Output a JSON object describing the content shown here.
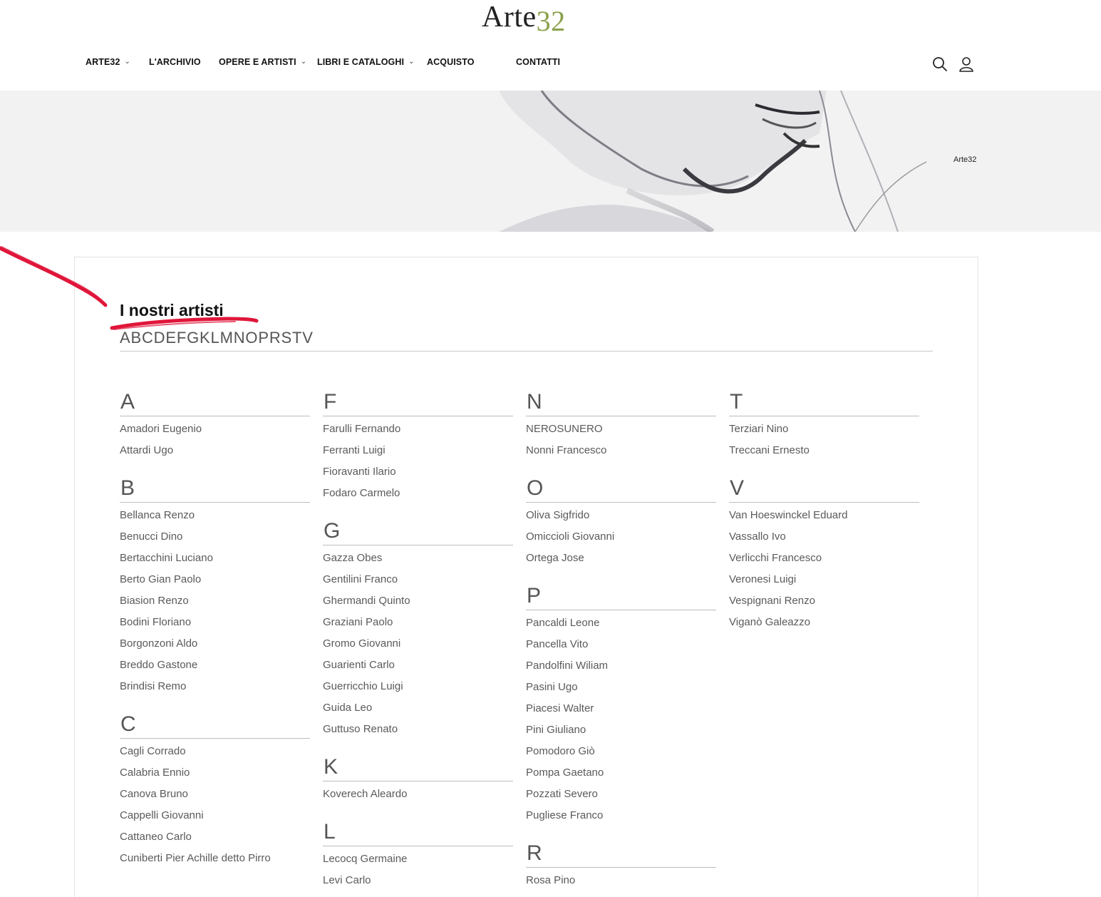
{
  "header": {
    "logo_text": "Arte",
    "logo_num": "32",
    "nav": [
      {
        "label": "ARTE32",
        "dropdown": true
      },
      {
        "label": "L'ARCHIVIO",
        "dropdown": false
      },
      {
        "label": "OPERE E ARTISTI",
        "dropdown": true
      },
      {
        "label": "LIBRI E CATALOGHI",
        "dropdown": true
      },
      {
        "label": "ACQUISTO",
        "dropdown": false
      },
      {
        "label": "CONTATTI",
        "dropdown": false
      }
    ],
    "icons": [
      "search-icon",
      "user-icon"
    ]
  },
  "hero": {
    "breadcrumb": "Arte32"
  },
  "main": {
    "title": "I nostri artisti",
    "alphabet": [
      "A",
      "B",
      "C",
      "D",
      "E",
      "F",
      "G",
      "K",
      "L",
      "M",
      "N",
      "O",
      "P",
      "R",
      "S",
      "T",
      "V"
    ]
  },
  "columns": [
    [
      {
        "letter": "A",
        "artists": [
          "Amadori Eugenio",
          "Attardi Ugo"
        ]
      },
      {
        "letter": "B",
        "artists": [
          "Bellanca Renzo",
          "Benucci Dino",
          "Bertacchini Luciano",
          "Berto Gian Paolo",
          "Biasion Renzo",
          "Bodini Floriano",
          "Borgonzoni Aldo",
          "Breddo Gastone",
          "Brindisi Remo"
        ]
      },
      {
        "letter": "C",
        "artists": [
          "Cagli Corrado",
          "Calabria Ennio",
          "Canova Bruno",
          "Cappelli Giovanni",
          "Cattaneo Carlo",
          "Cuniberti Pier Achille detto Pirro"
        ]
      }
    ],
    [
      {
        "letter": "F",
        "artists": [
          "Farulli Fernando",
          "Ferranti Luigi",
          "Fioravanti Ilario",
          "Fodaro Carmelo"
        ]
      },
      {
        "letter": "G",
        "artists": [
          "Gazza Obes",
          "Gentilini Franco",
          "Ghermandi Quinto",
          "Graziani Paolo",
          "Gromo Giovanni",
          "Guarienti Carlo",
          "Guerricchio Luigi",
          "Guida Leo",
          "Guttuso Renato"
        ]
      },
      {
        "letter": "K",
        "artists": [
          "Koverech Aleardo"
        ]
      },
      {
        "letter": "L",
        "artists": [
          "Lecocq Germaine",
          "Levi Carlo"
        ]
      }
    ],
    [
      {
        "letter": "N",
        "artists": [
          "NEROSUNERO",
          "Nonni Francesco"
        ]
      },
      {
        "letter": "O",
        "artists": [
          "Oliva Sigfrido",
          "Omiccioli Giovanni",
          "Ortega Jose"
        ]
      },
      {
        "letter": "P",
        "artists": [
          "Pancaldi Leone",
          "Pancella Vito",
          "Pandolfini Wiliam",
          "Pasini Ugo",
          "Piacesi Walter",
          "Pini Giuliano",
          "Pomodoro Giò",
          "Pompa Gaetano",
          "Pozzati Severo",
          "Pugliese Franco"
        ]
      },
      {
        "letter": "R",
        "artists": [
          "Rosa Pino"
        ]
      }
    ],
    [
      {
        "letter": "T",
        "artists": [
          "Terziari Nino",
          "Treccani Ernesto"
        ]
      },
      {
        "letter": "V",
        "artists": [
          "Van Hoeswinckel Eduard",
          "Vassallo Ivo",
          "Verlicchi Francesco",
          "Veronesi Luigi",
          "Vespignani Renzo",
          "Viganò Galeazzo"
        ]
      }
    ]
  ],
  "colors": {
    "accent_logo": "#8aa04a",
    "annotation": "#e0163a"
  }
}
